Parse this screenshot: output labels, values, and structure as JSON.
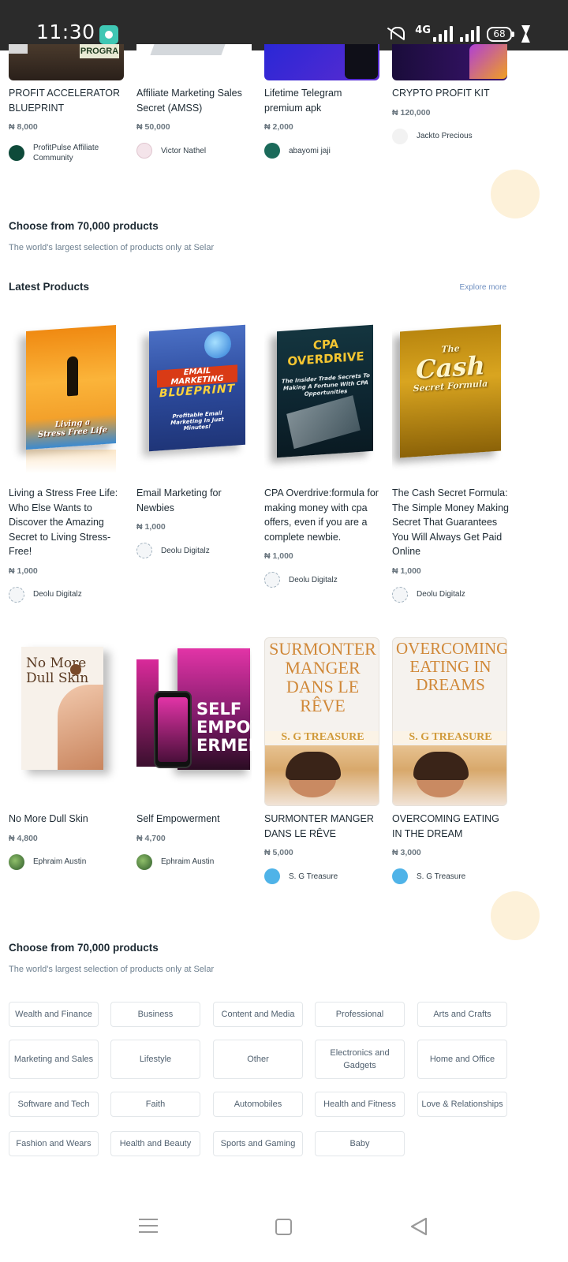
{
  "status_bar": {
    "time": "11:30",
    "network": "4G",
    "battery": "68"
  },
  "top_products": [
    {
      "title": "PROFIT ACCELERATOR BLUEPRINT",
      "price": "₦ 8,000",
      "seller": "ProfitPulse Affiliate Community",
      "thumb_text": "PROGRA"
    },
    {
      "title": "Affiliate Marketing Sales Secret (AMSS)",
      "price": "₦ 50,000",
      "seller": "Victor Nathel"
    },
    {
      "title": "Lifetime Telegram premium apk",
      "price": "₦ 2,000",
      "seller": "abayomi jaji"
    },
    {
      "title": "CRYPTO PROFIT KIT",
      "price": "₦ 120,000",
      "seller": "Jackto Precious"
    }
  ],
  "promo_top": {
    "title": "Choose from 70,000 products",
    "subtitle": "The world's largest selection of products only at Selar"
  },
  "latest": {
    "title": "Latest Products",
    "explore_label": "Explore more",
    "products": [
      {
        "title": "Living a Stress Free Life: Who Else Wants to Discover the Amazing Secret to Living Stress-Free!",
        "price": "₦ 1,000",
        "seller": "Deolu Digitalz",
        "cover_line1": "Living a",
        "cover_line2": "Stress Free Life"
      },
      {
        "title": "Email Marketing for Newbies",
        "price": "₦ 1,000",
        "seller": "Deolu Digitalz",
        "cover_line1": "EMAIL MARKETING",
        "cover_line2": "BLUEPRINT",
        "cover_line3": "Profitable Email Marketing In Just Minutes!"
      },
      {
        "title": "CPA Overdrive:formula for making money with cpa offers, even if you are a complete newbie.",
        "price": "₦ 1,000",
        "seller": "Deolu Digitalz",
        "cover_line1": "CPA OVERDRIVE",
        "cover_line2": "The Insider Trade Secrets To Making A Fortune With CPA Opportunities"
      },
      {
        "title": "The Cash Secret Formula: The Simple Money Making Secret That Guarantees You Will Always Get Paid Online",
        "price": "₦ 1,000",
        "seller": "Deolu Digitalz",
        "cover_line1": "The",
        "cover_line2": "Cash",
        "cover_line3": "Secret Formula"
      },
      {
        "title": "No More Dull Skin",
        "price": "₦ 4,800",
        "seller": "Ephraim Austin",
        "cover_line1": "No More",
        "cover_line2": "Dull Skin"
      },
      {
        "title": "Self Empowerment",
        "price": "₦ 4,700",
        "seller": "Ephraim Austin",
        "cover_line1": "SELF",
        "cover_line2": "EMPOW",
        "cover_line3": "ERMENT"
      },
      {
        "title": "SURMONTER MANGER DANS LE RÊVE",
        "price": "₦ 5,000",
        "seller": "S. G Treasure",
        "cover_line1": "SURMONTER MANGER DANS LE RÊVE",
        "cover_line2": "S. G TREASURE"
      },
      {
        "title": "OVERCOMING EATING IN THE DREAM",
        "price": "₦ 3,000",
        "seller": "S. G Treasure",
        "cover_line1": "OVERCOMING EATING IN DREAMS",
        "cover_line2": "S. G TREASURE"
      }
    ]
  },
  "promo_bottom": {
    "title": "Choose from 70,000 products",
    "subtitle": "The world's largest selection of products only at Selar"
  },
  "categories": [
    "Wealth and Finance",
    "Business",
    "Content and Media",
    "Professional",
    "Arts and Crafts",
    "Marketing and Sales",
    "Lifestyle",
    "Other",
    "Electronics and Gadgets",
    "Home and Office",
    "Software and Tech",
    "Faith",
    "Automobiles",
    "Health and Fitness",
    "Love & Relationships",
    "Fashion and Wears",
    "Health and Beauty",
    "Sports and Gaming",
    "Baby"
  ],
  "colors": {
    "deco_circle": "#fdf1d9",
    "status_bar": "#2b2b2b",
    "category_text": "#516170",
    "link": "#6f8fc0"
  }
}
